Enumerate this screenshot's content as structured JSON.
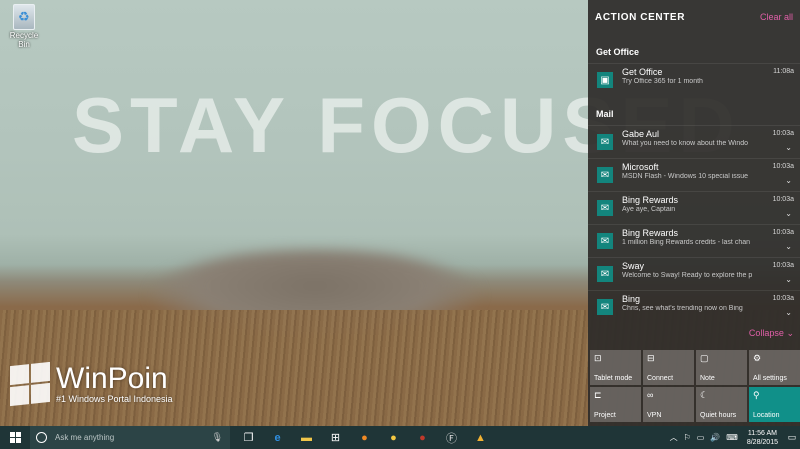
{
  "desktop": {
    "wallpaper_text": "STAY FOCUSED",
    "recycle_bin_label": "Recycle Bin",
    "watermark_name": "WinPoin",
    "watermark_tagline": "#1 Windows Portal Indonesia"
  },
  "action_center": {
    "title": "ACTION CENTER",
    "clear_all": "Clear all",
    "collapse": "Collapse",
    "groups": [
      {
        "name": "Get Office",
        "items": [
          {
            "title": "Get Office",
            "subtitle": "Try Office 365 for 1 month",
            "time": "11:08a"
          }
        ]
      },
      {
        "name": "Mail",
        "items": [
          {
            "title": "Gabe Aul",
            "subtitle": "What you need to know about the Windo",
            "time": "10:03a"
          },
          {
            "title": "Microsoft",
            "subtitle": "MSDN Flash - Windows 10 special issue",
            "time": "10:03a"
          },
          {
            "title": "Bing Rewards",
            "subtitle": "Aye aye, Captain",
            "time": "10:03a"
          },
          {
            "title": "Bing Rewards",
            "subtitle": "1 million Bing Rewards credits - last chan",
            "time": "10:03a"
          },
          {
            "title": "Sway",
            "subtitle": "Welcome to Sway! Ready to explore the p",
            "time": "10:03a"
          },
          {
            "title": "Bing",
            "subtitle": "Chris, see what's trending now on Bing",
            "time": "10:03a"
          }
        ]
      }
    ],
    "quick_actions": [
      {
        "label": "Tablet mode",
        "icon": "tablet-icon",
        "active": false
      },
      {
        "label": "Connect",
        "icon": "connect-icon",
        "active": false
      },
      {
        "label": "Note",
        "icon": "note-icon",
        "active": false
      },
      {
        "label": "All settings",
        "icon": "gear-icon",
        "active": false
      },
      {
        "label": "Project",
        "icon": "project-icon",
        "active": false
      },
      {
        "label": "VPN",
        "icon": "vpn-icon",
        "active": false
      },
      {
        "label": "Quiet hours",
        "icon": "moon-icon",
        "active": false
      },
      {
        "label": "Location",
        "icon": "location-icon",
        "active": true
      }
    ],
    "accent_color": "#109089",
    "link_color": "#e05fa8"
  },
  "taskbar": {
    "search_placeholder": "Ask me anything",
    "time": "11:56 AM",
    "date": "8/28/2015"
  }
}
